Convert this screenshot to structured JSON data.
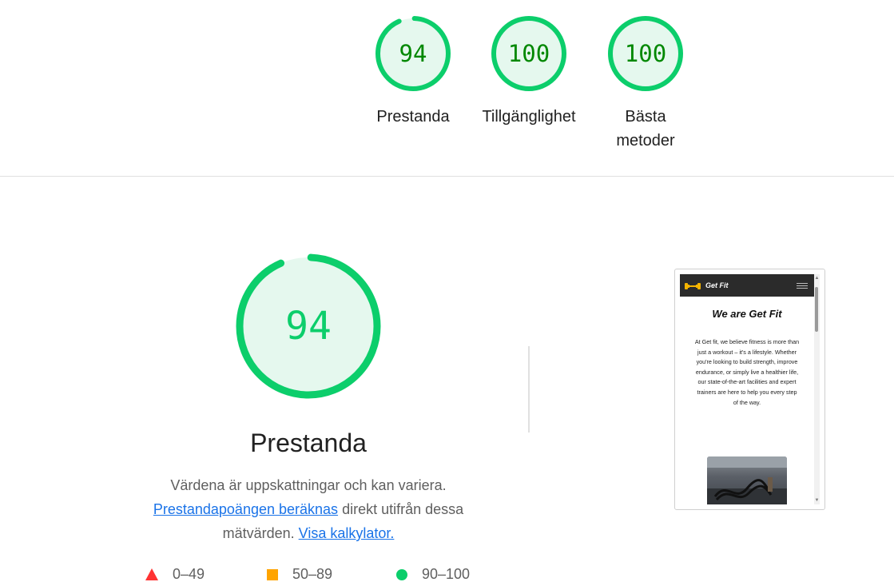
{
  "colors": {
    "pass": "#0cce6b",
    "pass_text": "#008800",
    "pass_fill": "#e5f8ee",
    "average": "#ffa400",
    "fail": "#ff3333",
    "link": "#1a73e8"
  },
  "summary_gauges": [
    {
      "score": "94",
      "label": "Prestanda",
      "fraction": 0.94
    },
    {
      "score": "100",
      "label": "Tillgänglighet",
      "fraction": 1.0
    },
    {
      "score": "100",
      "label_line1": "Bästa",
      "label_line2": "metoder",
      "fraction": 1.0
    }
  ],
  "performance": {
    "score": "94",
    "fraction": 0.94,
    "title": "Prestanda",
    "desc_text1": "Värdena är uppskattningar och kan variera.",
    "desc_link1": "Prestandapoängen beräknas",
    "desc_text2": "direkt utifrån dessa mätvärden.",
    "desc_link2": "Visa kalkylator."
  },
  "legend": [
    {
      "range": "0–49",
      "icon": "triangle-icon"
    },
    {
      "range": "50–89",
      "icon": "square-icon"
    },
    {
      "range": "90–100",
      "icon": "circle-icon"
    }
  ],
  "thumbnail": {
    "brand": "Get Fit",
    "heading": "We are Get Fit",
    "body": "At Get fit, we believe fitness is more than just a workout – it's a lifestyle. Whether you're looking to build strength, improve endurance, or simply live a healthier life, our state-of-the-art facilities and expert trainers are here to help you every step of the way."
  }
}
